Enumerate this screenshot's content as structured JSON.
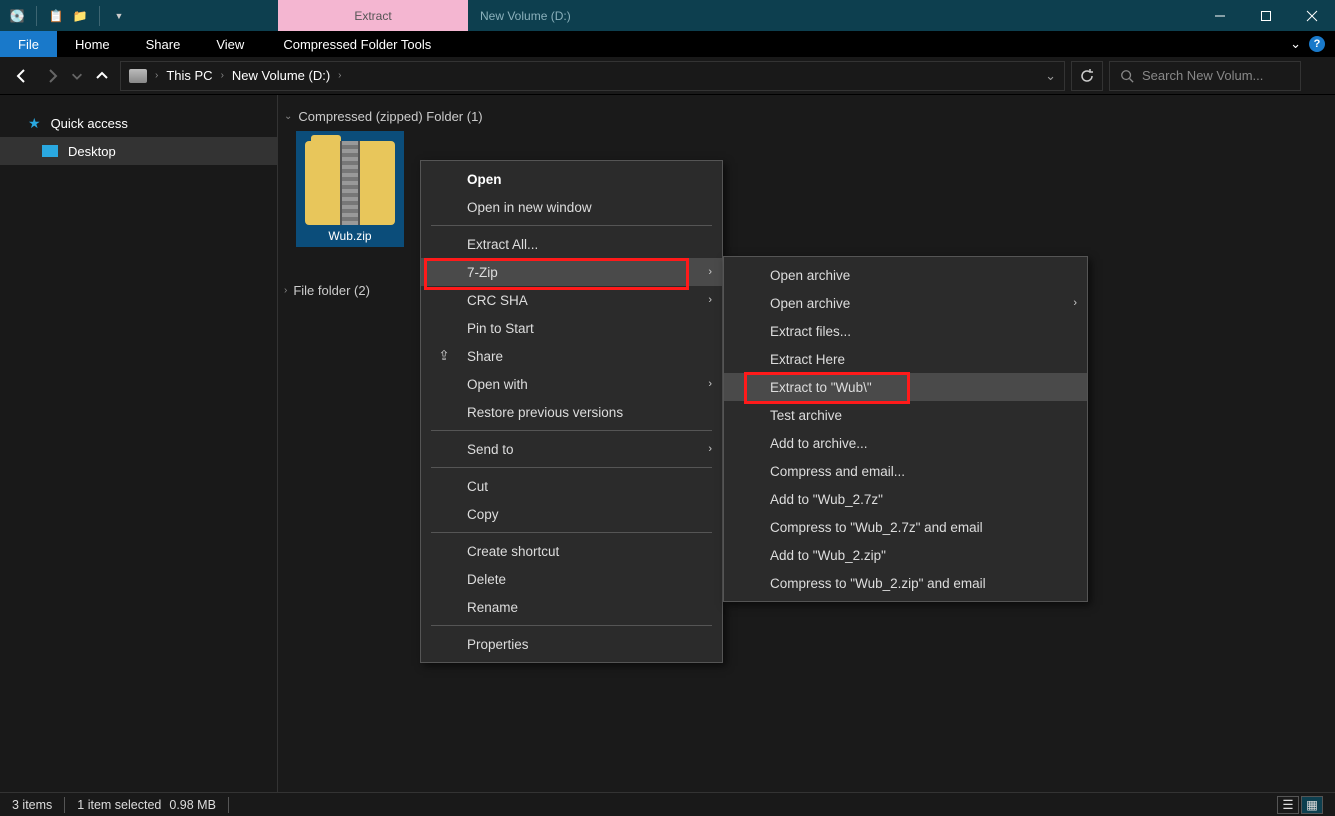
{
  "titlebar": {
    "contextual_label": "Extract",
    "window_title": "New Volume (D:)"
  },
  "ribbon": {
    "file": "File",
    "tabs": [
      "Home",
      "Share",
      "View"
    ],
    "contextual_tab": "Compressed Folder Tools"
  },
  "breadcrumb": {
    "items": [
      "This PC",
      "New Volume (D:)"
    ]
  },
  "search": {
    "placeholder": "Search New Volum..."
  },
  "sidebar": {
    "quick_access": "Quick access",
    "desktop": "Desktop"
  },
  "content": {
    "group1_label": "Compressed (zipped) Folder (1)",
    "file_name": "Wub.zip",
    "group2_label": "File folder (2)"
  },
  "context_menu": {
    "open": "Open",
    "open_new": "Open in new window",
    "extract_all": "Extract All...",
    "seven_zip": "7-Zip",
    "crc_sha": "CRC SHA",
    "pin": "Pin to Start",
    "share": "Share",
    "open_with": "Open with",
    "restore": "Restore previous versions",
    "send_to": "Send to",
    "cut": "Cut",
    "copy": "Copy",
    "create_shortcut": "Create shortcut",
    "delete": "Delete",
    "rename": "Rename",
    "properties": "Properties"
  },
  "sub_menu": {
    "open_archive1": "Open archive",
    "open_archive2": "Open archive",
    "extract_files": "Extract files...",
    "extract_here": "Extract Here",
    "extract_to": "Extract to \"Wub\\\"",
    "test": "Test archive",
    "add_archive": "Add to archive...",
    "compress_email": "Compress and email...",
    "add_7z": "Add to \"Wub_2.7z\"",
    "compress_7z_email": "Compress to \"Wub_2.7z\" and email",
    "add_zip": "Add to \"Wub_2.zip\"",
    "compress_zip_email": "Compress to \"Wub_2.zip\" and email"
  },
  "status": {
    "items": "3 items",
    "selected": "1 item selected",
    "size": "0.98 MB"
  }
}
